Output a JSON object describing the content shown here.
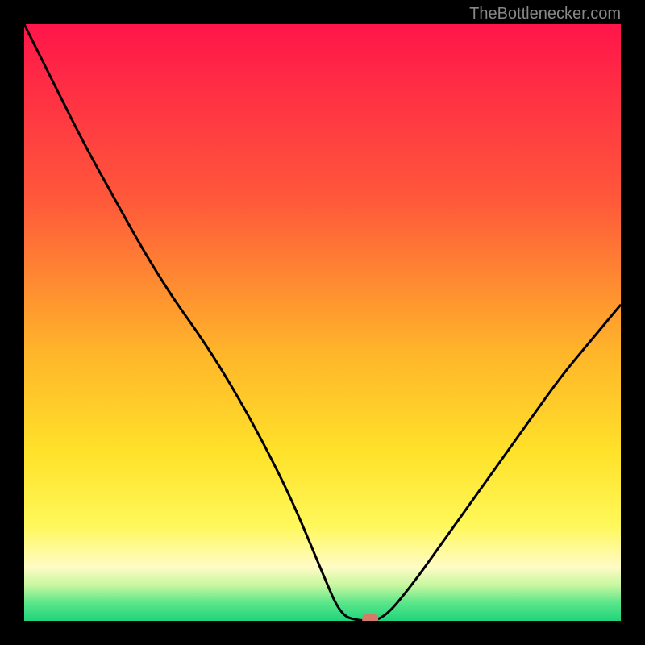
{
  "attribution": "TheBottlenecker.com",
  "chart_data": {
    "type": "line",
    "title": "",
    "xlabel": "",
    "ylabel": "",
    "xlim": [
      0,
      100
    ],
    "ylim": [
      0,
      100
    ],
    "x": [
      0,
      5,
      10,
      15,
      20,
      25,
      30,
      35,
      40,
      45,
      50,
      53,
      56,
      60,
      65,
      70,
      75,
      80,
      85,
      90,
      95,
      100
    ],
    "series": [
      {
        "name": "curve",
        "values": [
          100,
          90,
          80,
          71,
          62,
          54,
          47,
          39,
          30,
          20,
          8,
          1,
          0,
          0,
          6,
          13,
          20,
          27,
          34,
          41,
          47,
          53
        ]
      }
    ],
    "marker": {
      "x": 58,
      "y": 0
    },
    "gradient_stops": [
      {
        "offset": 0,
        "color": "#ff154a"
      },
      {
        "offset": 30,
        "color": "#ff5a3a"
      },
      {
        "offset": 55,
        "color": "#ffb52a"
      },
      {
        "offset": 72,
        "color": "#ffe22a"
      },
      {
        "offset": 84,
        "color": "#fff85a"
      },
      {
        "offset": 91,
        "color": "#fffbc5"
      },
      {
        "offset": 94,
        "color": "#c8f7a0"
      },
      {
        "offset": 97,
        "color": "#5be68a"
      },
      {
        "offset": 100,
        "color": "#1fd47a"
      }
    ]
  }
}
